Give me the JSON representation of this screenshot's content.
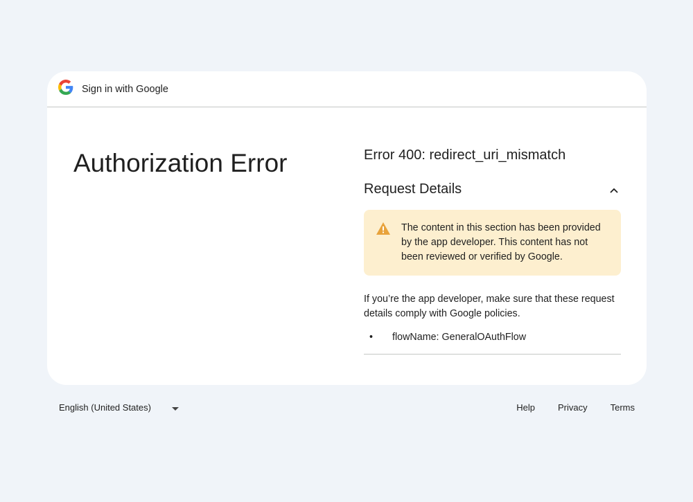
{
  "header": {
    "title": "Sign in with Google",
    "logo_icon": "google-g-icon"
  },
  "main": {
    "title": "Authorization Error",
    "error": "Error 400: redirect_uri_mismatch",
    "request_details": "Request Details",
    "warning": "The content in this section has been provided by the app developer. This content has not been reviewed or verified by Google.",
    "developer_note": "If you’re the app developer, make sure that these request details comply with Google policies.",
    "details": [
      "flowName: GeneralOAuthFlow"
    ]
  },
  "footer": {
    "language": "English (United States)",
    "links": [
      "Help",
      "Privacy",
      "Terms"
    ]
  },
  "colors": {
    "background": "#f0f4f9",
    "warning_bg": "#fdefcf",
    "warning_icon": "#e37400"
  }
}
